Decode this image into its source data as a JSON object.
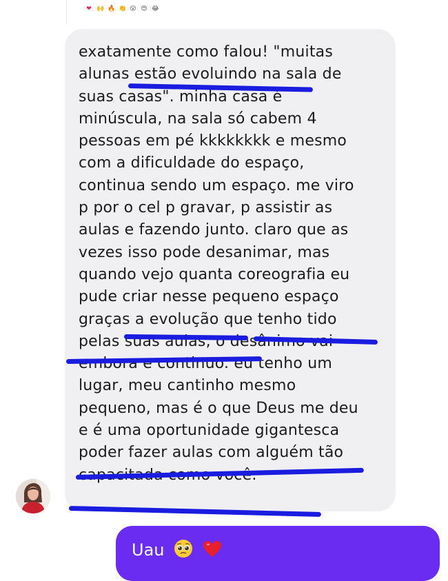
{
  "header": {
    "reactions": [
      "❤",
      "🙌",
      "🔥",
      "👏",
      "😮",
      "😍",
      "😂"
    ]
  },
  "message": {
    "lines": [
      "exatamente como falou! \"muitas",
      "alunas estão evoluindo na sala de",
      "suas casas\". minha casa é",
      "minúscula, na sala só cabem 4",
      "pessoas em pé kkkkkkkk e mesmo",
      "com a dificuldade do espaço,",
      "continua sendo um espaço. me viro",
      "p por o cel p gravar, p assistir as",
      "aulas e fazendo junto. claro que as",
      "vezes isso pode desanimar, mas",
      "quando vejo quanta coreografia eu",
      "pude criar nesse pequeno espaço",
      "graças a evolução que tenho tido",
      "pelas suas aulas, o desânimo vai",
      "embora e continuo. eu tenho um",
      "lugar, meu cantinho mesmo",
      "pequeno, mas é o que Deus me deu",
      "e é uma oportunidade gigantesca",
      "poder fazer aulas com alguém tão",
      "capacitada como você."
    ]
  },
  "reply": {
    "text": "Uau"
  },
  "colors": {
    "bubble_received": "#f0f0f2",
    "bubble_sent": "#6a2cf0",
    "highlight_marker": "#1a1ce0"
  }
}
